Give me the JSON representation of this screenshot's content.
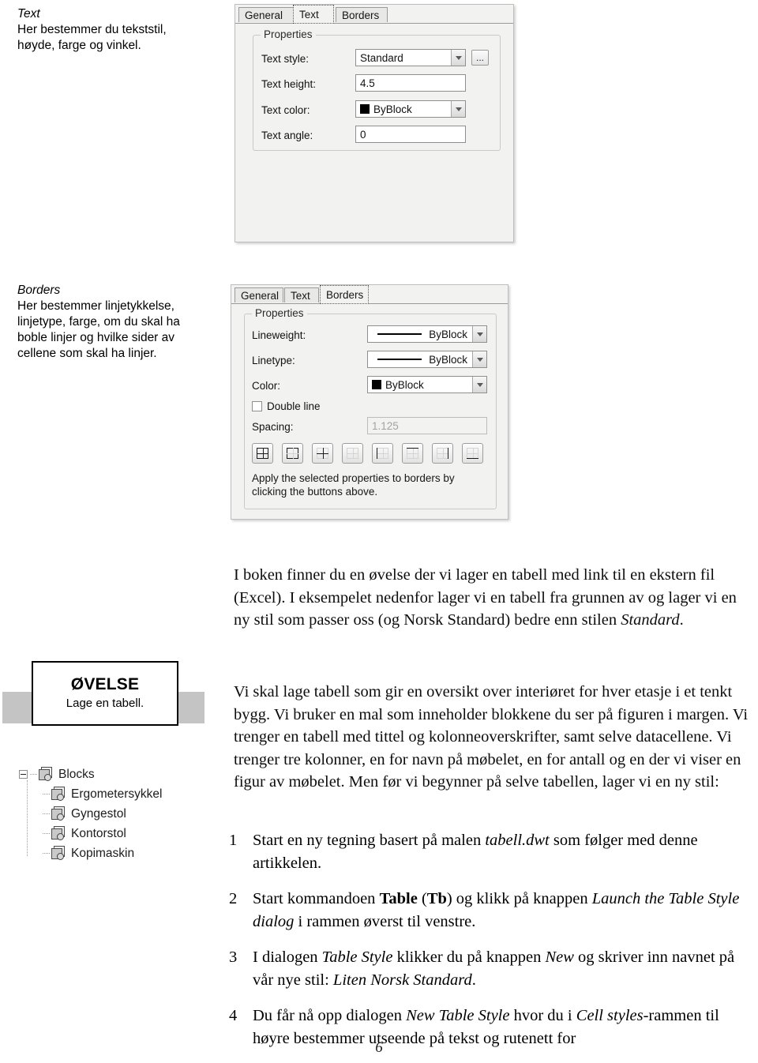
{
  "margin_notes": [
    {
      "title": "Text",
      "body": "Her bestemmer du tekststil, høyde, farge og vinkel."
    },
    {
      "title": "Borders",
      "body": "Her bestemmer linjetykkelse, linjetype, farge, om du skal ha boble linjer og hvilke sider av cellene som skal ha linjer."
    }
  ],
  "dialog_text": {
    "tabs": [
      "General",
      "Text",
      "Borders"
    ],
    "active_tab": "Text",
    "group_legend": "Properties",
    "fields": {
      "text_style": {
        "label": "Text style:",
        "value": "Standard"
      },
      "text_height": {
        "label": "Text height:",
        "value": "4.5"
      },
      "text_color": {
        "label": "Text color:",
        "value": "ByBlock",
        "swatch": "#000000"
      },
      "text_angle": {
        "label": "Text angle:",
        "value": "0"
      }
    },
    "ellipsis_button": "...",
    "icons": {
      "dropdown": "chevron-down-icon",
      "browse": "ellipsis-button-icon"
    }
  },
  "dialog_borders": {
    "tabs": [
      "General",
      "Text",
      "Borders"
    ],
    "active_tab": "Borders",
    "group_legend": "Properties",
    "fields": {
      "lineweight": {
        "label": "Lineweight:",
        "value": "ByBlock"
      },
      "linetype": {
        "label": "Linetype:",
        "value": "ByBlock"
      },
      "color": {
        "label": "Color:",
        "value": "ByBlock",
        "swatch": "#000000"
      },
      "double_line": {
        "label": "Double line",
        "checked": false
      },
      "spacing": {
        "label": "Spacing:",
        "value": "1.125",
        "disabled": true
      }
    },
    "border_buttons": [
      "all-borders",
      "outside-borders",
      "inside-borders",
      "no-borders",
      "left-border",
      "right-border",
      "top-border",
      "bottom-border"
    ],
    "hint": "Apply the selected properties to borders by clicking the buttons above."
  },
  "exercise_box": {
    "title": "ØVELSE",
    "subtitle": "Lage en tabell."
  },
  "tree": {
    "root": "Blocks",
    "children": [
      "Ergometersykkel",
      "Gyngestol",
      "Kontorstol",
      "Kopimaskin"
    ]
  },
  "paragraphs": {
    "intro_1": "I boken finner du en øvelse der vi lager en tabell med link til en ekstern fil (Excel). I eksempelet nedenfor lager vi en tabell fra grunnen av og lager vi en ny stil som passer oss (og Norsk Standard) bedre enn stilen ",
    "intro_em": "Standard",
    "intro_2": ".",
    "main": "Vi skal lage tabell som gir en oversikt over interiøret for hver etasje i et tenkt bygg. Vi bruker en mal som inneholder blokkene du ser på figuren i margen. Vi trenger en tabell med tittel og kolonneoverskrifter, samt selve datacellene. Vi trenger tre kolonner, en for navn på møbelet, en for antall og en der vi viser en figur av møbelet. Men før vi begynner på selve tabellen, lager vi en ny stil:"
  },
  "steps": [
    {
      "num": "1",
      "parts": [
        {
          "t": "Start en ny tegning basert på malen ",
          "s": "normal"
        },
        {
          "t": "tabell.dwt",
          "s": "italic"
        },
        {
          "t": " som følger med denne artikkelen.",
          "s": "normal"
        }
      ]
    },
    {
      "num": "2",
      "parts": [
        {
          "t": "Start kommandoen ",
          "s": "normal"
        },
        {
          "t": "Table",
          "s": "bold"
        },
        {
          "t": " (",
          "s": "normal"
        },
        {
          "t": "Tb",
          "s": "bold"
        },
        {
          "t": ") og klikk på knappen ",
          "s": "normal"
        },
        {
          "t": "Launch the Table Style dialog",
          "s": "italic"
        },
        {
          "t": " i rammen øverst til venstre.",
          "s": "normal"
        }
      ]
    },
    {
      "num": "3",
      "parts": [
        {
          "t": "I dialogen ",
          "s": "normal"
        },
        {
          "t": "Table Style",
          "s": "italic"
        },
        {
          "t": " klikker du på knappen ",
          "s": "normal"
        },
        {
          "t": "New",
          "s": "italic"
        },
        {
          "t": " og skriver inn navnet på vår nye stil: ",
          "s": "normal"
        },
        {
          "t": "Liten Norsk Standard",
          "s": "italic"
        },
        {
          "t": ".",
          "s": "normal"
        }
      ]
    },
    {
      "num": "4",
      "parts": [
        {
          "t": "Du får nå opp dialogen ",
          "s": "normal"
        },
        {
          "t": "New Table Style",
          "s": "italic"
        },
        {
          "t": " hvor du i ",
          "s": "normal"
        },
        {
          "t": "Cell styles",
          "s": "italic"
        },
        {
          "t": "-rammen til høyre bestemmer utseende på tekst og rutenett for",
          "s": "normal"
        }
      ]
    }
  ],
  "page_number": "6"
}
